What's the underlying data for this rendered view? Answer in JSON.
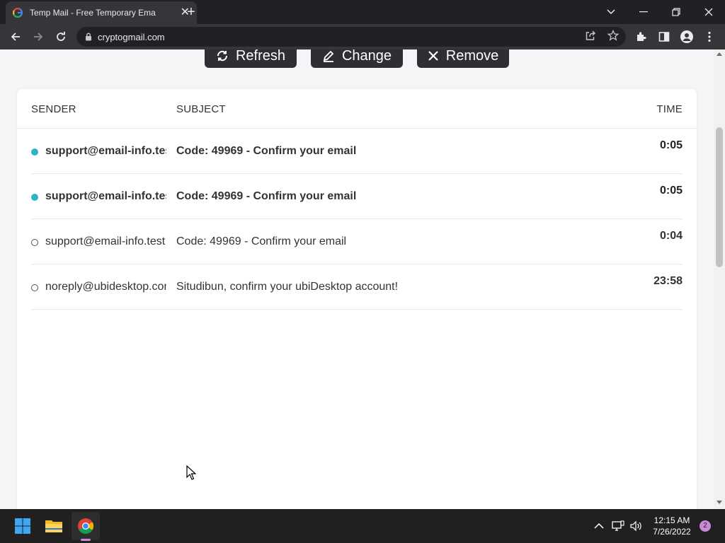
{
  "browser": {
    "tab_title": "Temp Mail - Free Temporary Ema",
    "url": "cryptogmail.com"
  },
  "actions": {
    "refresh_label": "Refresh",
    "change_label": "Change",
    "remove_label": "Remove"
  },
  "inbox": {
    "columns": {
      "sender": "SENDER",
      "subject": "SUBJECT",
      "time": "TIME"
    },
    "rows": [
      {
        "sender": "support@email-info.test",
        "subject": "Code: 49969 - Confirm your email",
        "time": "0:05",
        "unread": true
      },
      {
        "sender": "support@email-info.test",
        "subject": "Code: 49969 - Confirm your email",
        "time": "0:05",
        "unread": true
      },
      {
        "sender": "support@email-info.test",
        "subject": "Code: 49969 - Confirm your email",
        "time": "0:04",
        "unread": false
      },
      {
        "sender": "noreply@ubidesktop.com",
        "subject": "Situdibun, confirm your ubiDesktop account!",
        "time": "23:58",
        "unread": false
      }
    ]
  },
  "taskbar": {
    "time": "12:15 AM",
    "date": "7/26/2022",
    "notification_count": "2"
  },
  "colors": {
    "unread_dot": "#2fb4c4",
    "button_bg": "#2d2f33",
    "chrome_dark": "#202124"
  }
}
